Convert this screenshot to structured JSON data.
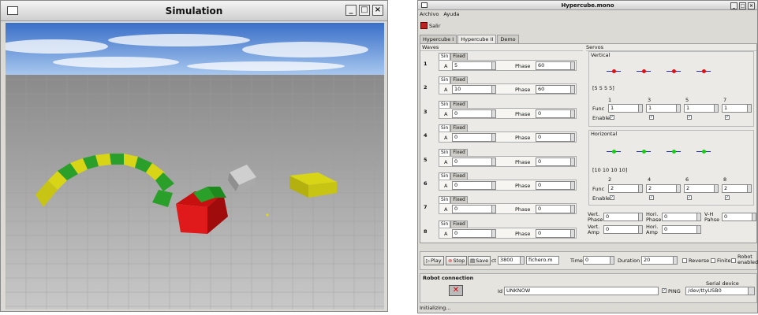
{
  "simulation": {
    "title": "Simulation",
    "controls": {
      "minimize": "_",
      "maximize": "□",
      "close": "×"
    }
  },
  "hypercube": {
    "title": "Hypercube.mono",
    "menu": [
      "Archivo",
      "Ayuda"
    ],
    "toolbar": {
      "exit_label": "Salir"
    },
    "tabs": [
      "Hypercube I",
      "Hypercube II",
      "Demo"
    ],
    "waves": {
      "title": "Waves",
      "items": [
        {
          "num": "1",
          "tabs": [
            "Sin",
            "Fixed"
          ],
          "a_label": "A",
          "a": "5",
          "phase_label": "Phase",
          "phase": "60"
        },
        {
          "num": "2",
          "tabs": [
            "Sin",
            "Fixed"
          ],
          "a_label": "A",
          "a": "10",
          "phase_label": "Phase",
          "phase": "60"
        },
        {
          "num": "3",
          "tabs": [
            "Sin",
            "Fixed"
          ],
          "a_label": "A",
          "a": "0",
          "phase_label": "Phase",
          "phase": "0"
        },
        {
          "num": "4",
          "tabs": [
            "Sin",
            "Fixed"
          ],
          "a_label": "A",
          "a": "0",
          "phase_label": "Phase",
          "phase": "0"
        },
        {
          "num": "5",
          "tabs": [
            "Sin",
            "Fixed"
          ],
          "a_label": "A",
          "a": "0",
          "phase_label": "Phase",
          "phase": "0"
        },
        {
          "num": "6",
          "tabs": [
            "Sin",
            "Fixed"
          ],
          "a_label": "A",
          "a": "0",
          "phase_label": "Phase",
          "phase": "0"
        },
        {
          "num": "7",
          "tabs": [
            "Sin",
            "Fixed"
          ],
          "a_label": "A",
          "a": "0",
          "phase_label": "Phase",
          "phase": "0"
        },
        {
          "num": "8",
          "tabs": [
            "Sin",
            "Fixed"
          ],
          "a_label": "A",
          "a": "0",
          "phase_label": "Phase",
          "phase": "0"
        }
      ]
    },
    "servos": {
      "title": "Servos",
      "vertical": {
        "title": "Vertical",
        "summary": "[5 5 5 5]",
        "numbers": [
          "1",
          "3",
          "5",
          "7"
        ],
        "func_label": "Func",
        "func_values": [
          "1",
          "1",
          "1",
          "1"
        ],
        "enable_label": "Enable",
        "dot_color": "#e01010"
      },
      "horizontal": {
        "title": "Horizontal",
        "summary": "[10 10 10 10]",
        "numbers": [
          "2",
          "4",
          "6",
          "8"
        ],
        "func_label": "Func",
        "func_values": [
          "2",
          "2",
          "2",
          "2"
        ],
        "enable_label": "Enable",
        "dot_color": "#10d010"
      },
      "vert_phase_label": "Vert. Phase",
      "vert_phase": "0",
      "hori_phase_label": "Hori. Phase",
      "hori_phase": "0",
      "vh_phase_label": "V-H Pahse",
      "vh_phase": "0",
      "vert_amp_label": "Vert. Amp",
      "vert_amp": "0",
      "hori_amp_label": "Hori. Amp",
      "hori_amp": "0"
    },
    "controls": {
      "play": "Play",
      "stop": "Stop",
      "save": "Save",
      "ct_label": "ct",
      "ct": "3800",
      "file": "fichero.m",
      "time_label": "Time",
      "time": "0",
      "duration_label": "Duration",
      "duration": "20",
      "reverse": "Reverse",
      "finite": "Finite",
      "robot_enabled": "Robot enabled"
    },
    "robot": {
      "title": "Robot connection",
      "id_label": "Id",
      "id": "UNKNOW",
      "ping_label": "PING",
      "serial_label": "Serial device",
      "serial": "/dev/ttyUSB0"
    },
    "status": "Initializing..."
  }
}
